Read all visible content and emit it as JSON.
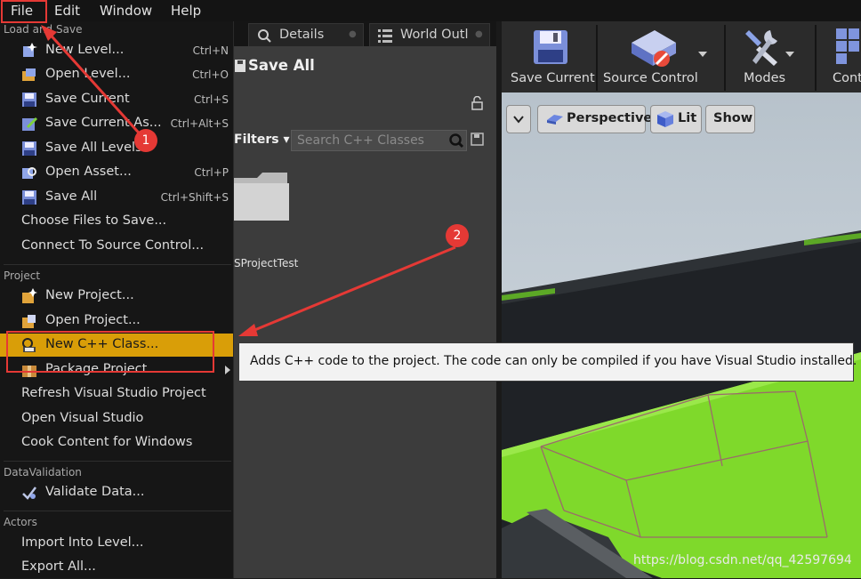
{
  "menubar": {
    "items": [
      {
        "label": "File"
      },
      {
        "label": "Edit"
      },
      {
        "label": "Window"
      },
      {
        "label": "Help"
      }
    ]
  },
  "file_menu": {
    "sections": {
      "load_and_save": "Load and Save",
      "project": "Project",
      "data_validation": "DataValidation",
      "actors": "Actors"
    },
    "load_and_save_items": [
      {
        "label": "New Level...",
        "shortcut": "Ctrl+N",
        "icon": "new-level-icon"
      },
      {
        "label": "Open Level...",
        "shortcut": "Ctrl+O",
        "icon": "open-level-icon"
      },
      {
        "label": "Save Current",
        "shortcut": "Ctrl+S",
        "icon": "save-icon"
      },
      {
        "label": "Save Current As...",
        "shortcut": "Ctrl+Alt+S",
        "icon": "save-as-icon"
      },
      {
        "label": "Save All Levels",
        "shortcut": "",
        "icon": "save-all-levels-icon"
      },
      {
        "label": "Open Asset...",
        "shortcut": "Ctrl+P",
        "icon": "open-asset-icon"
      },
      {
        "label": "Save All",
        "shortcut": "Ctrl+Shift+S",
        "icon": "save-all-icon"
      },
      {
        "label": "Choose Files to Save...",
        "shortcut": "",
        "icon": ""
      },
      {
        "label": "Connect To Source Control...",
        "shortcut": "",
        "icon": ""
      }
    ],
    "project_items": [
      {
        "label": "New Project...",
        "icon": "new-project-icon"
      },
      {
        "label": "Open Project...",
        "icon": "open-project-icon"
      },
      {
        "label": "New C++ Class...",
        "icon": "cpp-class-icon",
        "highlighted": true
      },
      {
        "label": "Package Project",
        "icon": "package-icon",
        "submenu": true
      },
      {
        "label": "Refresh Visual Studio Project",
        "icon": ""
      },
      {
        "label": "Open Visual Studio",
        "icon": ""
      },
      {
        "label": "Cook Content for Windows",
        "icon": ""
      }
    ],
    "data_validation_items": [
      {
        "label": "Validate Data...",
        "icon": "validate-icon"
      }
    ],
    "actors_items": [
      {
        "label": "Import Into Level..."
      },
      {
        "label": "Export All..."
      }
    ]
  },
  "tooltip": "Adds C++ code to the project. The code can only be compiled if you have Visual Studio installed.",
  "tabs": [
    {
      "label": "Details",
      "icon": "search-icon"
    },
    {
      "label": "World Outl",
      "icon": "list-icon"
    }
  ],
  "content_browser": {
    "save_all": "Save All",
    "filters": "Filters",
    "search_placeholder": "Search C++ Classes",
    "folder_label": "SProjectTest"
  },
  "toolbar": {
    "buttons": [
      {
        "label": "Save Current",
        "icon": "save-icon"
      },
      {
        "label": "Source Control",
        "icon": "source-control-icon"
      },
      {
        "label": "Modes",
        "icon": "modes-icon"
      },
      {
        "label": "Cont",
        "icon": "content-icon"
      }
    ]
  },
  "viewport": {
    "perspective": "Perspective",
    "lit": "Lit",
    "show": "Show"
  },
  "annotations": {
    "badge1": "1",
    "badge2": "2",
    "color": "#e53935"
  },
  "watermark": "https://blog.csdn.net/qq_42597694"
}
